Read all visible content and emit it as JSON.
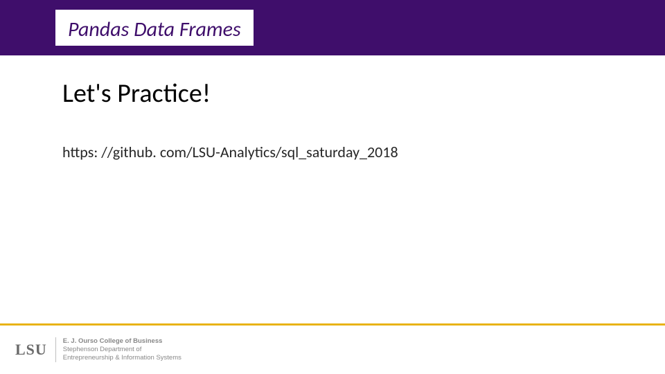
{
  "header": {
    "title": "Pandas Data Frames"
  },
  "main": {
    "heading": "Let's Practice!",
    "url": "https: //github. com/LSU-Analytics/sql_saturday_2018"
  },
  "footer": {
    "logo_text": "LSU",
    "dept_line1": "E. J. Ourso College of Business",
    "dept_line2": "Stephenson Department of",
    "dept_line3": "Entrepreneurship & Information Systems"
  },
  "colors": {
    "purple": "#3f0e6b",
    "gold": "#e8b315"
  }
}
